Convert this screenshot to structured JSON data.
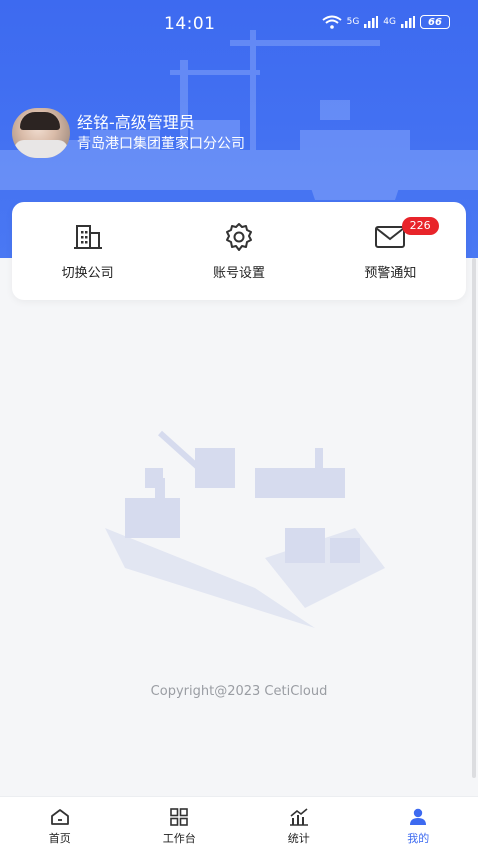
{
  "status_bar": {
    "time": "14:01",
    "signal_5g": "5G",
    "signal_4g": "4G",
    "battery": "66"
  },
  "profile": {
    "name": "经铭-高级管理员",
    "company": "青岛港口集团董家口分公司"
  },
  "actions": [
    {
      "label": "切换公司",
      "icon": "building-icon"
    },
    {
      "label": "账号设置",
      "icon": "gear-icon"
    },
    {
      "label": "预警通知",
      "icon": "mail-icon",
      "badge": "226"
    }
  ],
  "footer": {
    "copyright": "Copyright@2023 CetiCloud"
  },
  "tabs": [
    {
      "label": "首页",
      "icon": "home-icon",
      "active": false
    },
    {
      "label": "工作台",
      "icon": "grid-icon",
      "active": false
    },
    {
      "label": "统计",
      "icon": "chart-icon",
      "active": false
    },
    {
      "label": "我的",
      "icon": "user-icon",
      "active": true
    }
  ],
  "colors": {
    "primary": "#3d6af0",
    "badge": "#e8242a"
  }
}
